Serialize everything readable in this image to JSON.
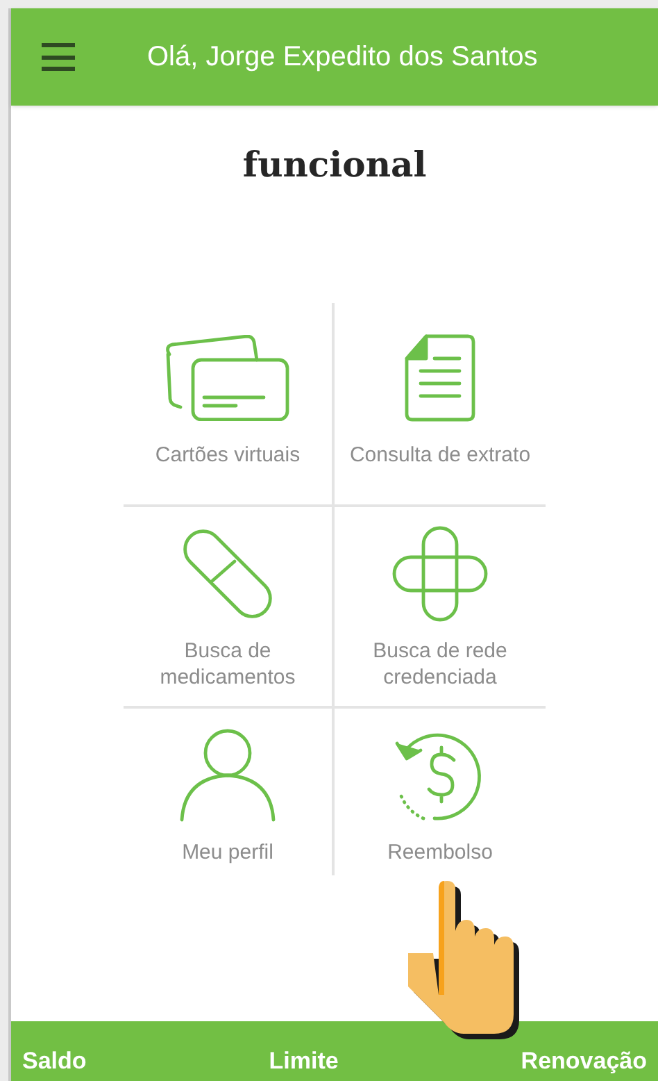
{
  "header": {
    "greeting": "Olá, Jorge Expedito dos Santos"
  },
  "logo": {
    "text": "funcional"
  },
  "menu": [
    {
      "kind": "cards",
      "label": "Cartões virtuais"
    },
    {
      "kind": "document",
      "label": "Consulta de extrato"
    },
    {
      "kind": "pill",
      "label": "Busca de medicamentos"
    },
    {
      "kind": "cross",
      "label": "Busca de rede credenciada"
    },
    {
      "kind": "person",
      "label": "Meu perfil"
    },
    {
      "kind": "refund",
      "label": "Reembolso"
    }
  ],
  "bottom_bar": [
    "Saldo",
    "Limite",
    "Renovação"
  ]
}
